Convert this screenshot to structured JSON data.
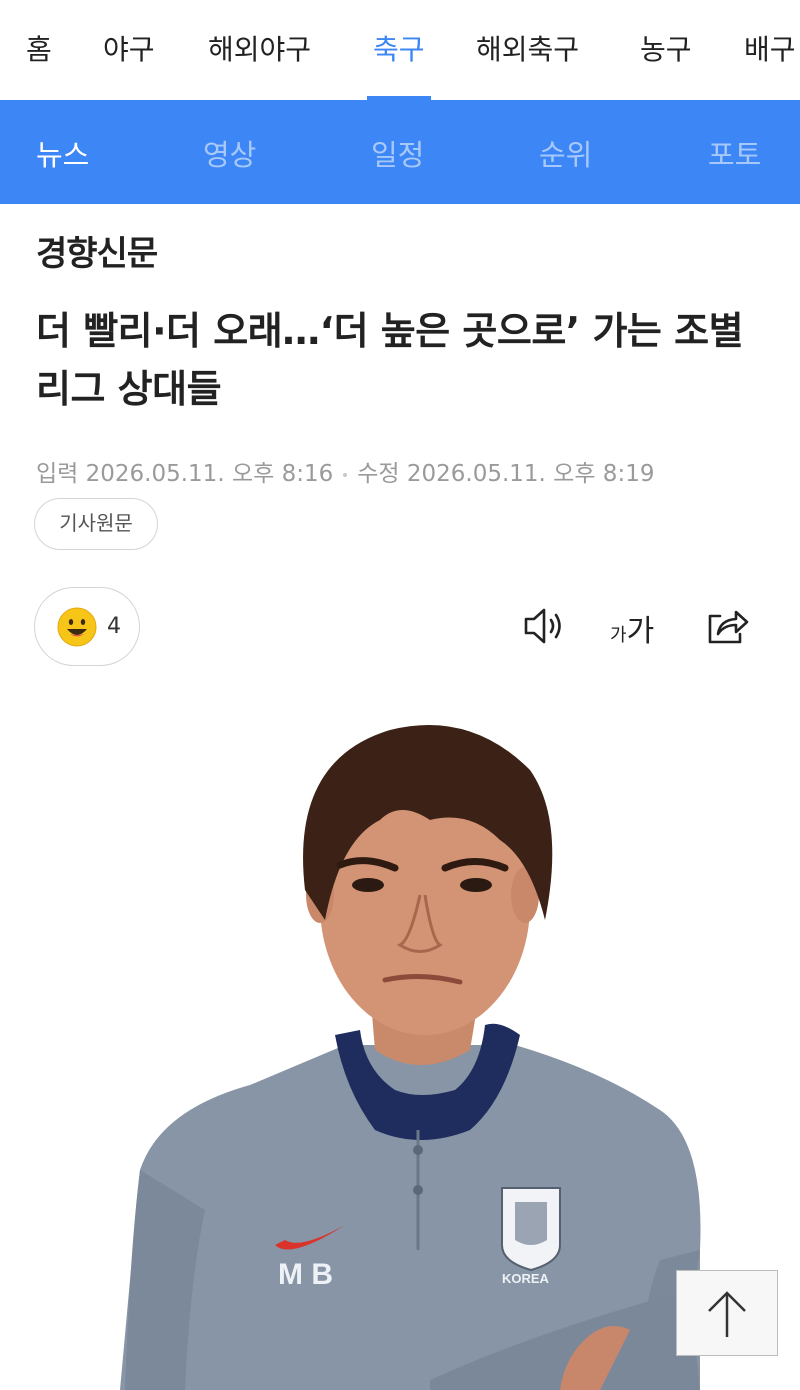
{
  "top_nav": {
    "items": [
      {
        "label": "홈"
      },
      {
        "label": "야구"
      },
      {
        "label": "해외야구"
      },
      {
        "label": "축구",
        "active": true
      },
      {
        "label": "해외축구"
      },
      {
        "label": "농구"
      },
      {
        "label": "배구"
      }
    ],
    "accent_color": "#3d86f5"
  },
  "sub_nav": {
    "items": [
      {
        "label": "뉴스",
        "active": true
      },
      {
        "label": "영상"
      },
      {
        "label": "일정"
      },
      {
        "label": "순위"
      },
      {
        "label": "포토"
      }
    ],
    "background_color": "#3d86f5"
  },
  "article": {
    "press": "경향신문",
    "headline": "더 빨리·더 오래…‘더 높은 곳으로’ 가는 조별리그 상대들",
    "input_time": "입력 2026.05.11. 오후 8:16",
    "modified_time": "수정 2026.05.11. 오후 8:19",
    "original_button": "기사원문",
    "reaction": {
      "icon": "smiling-face-icon",
      "count": "4"
    },
    "tools": {
      "tts_icon": "speaker-icon",
      "font_small": "가",
      "font_big": "가",
      "share_icon": "share-icon"
    },
    "photo": {
      "chest_logo": "M B",
      "badge_text": "KOREA"
    }
  },
  "scroll_top": {
    "icon": "arrow-up-icon"
  }
}
